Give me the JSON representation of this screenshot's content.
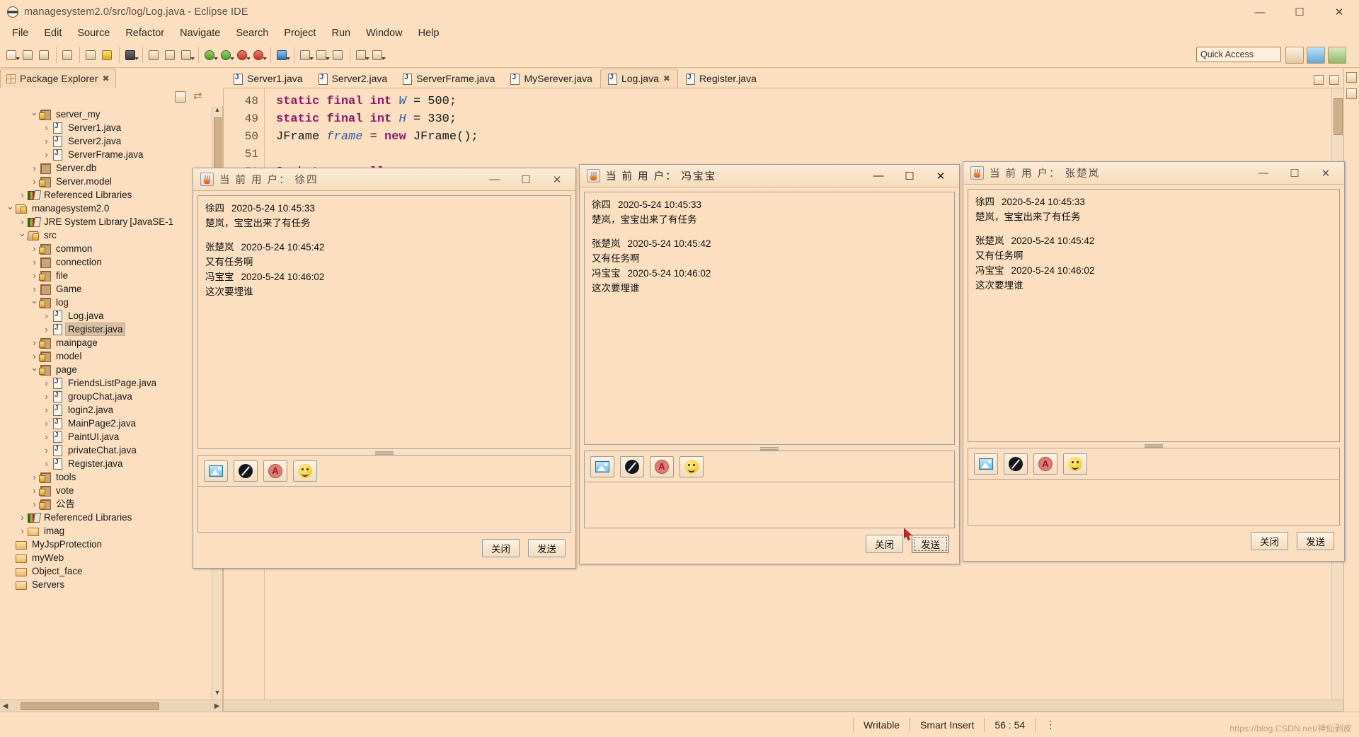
{
  "window": {
    "title": "managesystem2.0/src/log/Log.java - Eclipse IDE",
    "minimize": "—",
    "maximize": "☐",
    "close": "✕"
  },
  "menubar": [
    "File",
    "Edit",
    "Source",
    "Refactor",
    "Navigate",
    "Search",
    "Project",
    "Run",
    "Window",
    "Help"
  ],
  "toolbar": {
    "quick_access": "Quick Access"
  },
  "explorer": {
    "tab_label": "Package Explorer",
    "tab_close": "✖",
    "items": [
      {
        "label": "server_my",
        "indent": 3,
        "arrow": "open",
        "icon": "pkg-lock"
      },
      {
        "label": "Server1.java",
        "indent": 4,
        "arrow": "closed",
        "icon": "java"
      },
      {
        "label": "Server2.java",
        "indent": 4,
        "arrow": "closed",
        "icon": "java"
      },
      {
        "label": "ServerFrame.java",
        "indent": 4,
        "arrow": "closed",
        "icon": "java"
      },
      {
        "label": "Server.db",
        "indent": 3,
        "arrow": "closed",
        "icon": "pkg"
      },
      {
        "label": "Server.model",
        "indent": 3,
        "arrow": "closed",
        "icon": "pkg-lock"
      },
      {
        "label": "Referenced Libraries",
        "indent": 2,
        "arrow": "closed",
        "icon": "lib"
      },
      {
        "label": "managesystem2.0",
        "indent": 1,
        "arrow": "open",
        "icon": "proj"
      },
      {
        "label": "JRE System Library",
        "dim": " [JavaSE-1",
        "indent": 2,
        "arrow": "closed",
        "icon": "lib"
      },
      {
        "label": "src",
        "indent": 2,
        "arrow": "open",
        "icon": "src"
      },
      {
        "label": "common",
        "indent": 3,
        "arrow": "closed",
        "icon": "pkg-lock"
      },
      {
        "label": "connection",
        "indent": 3,
        "arrow": "closed",
        "icon": "pkg"
      },
      {
        "label": "file",
        "indent": 3,
        "arrow": "closed",
        "icon": "pkg-lock"
      },
      {
        "label": "Game",
        "indent": 3,
        "arrow": "closed",
        "icon": "pkg"
      },
      {
        "label": "log",
        "indent": 3,
        "arrow": "open",
        "icon": "pkg-lock"
      },
      {
        "label": "Log.java",
        "indent": 4,
        "arrow": "closed",
        "icon": "java"
      },
      {
        "label": "Register.java",
        "indent": 4,
        "arrow": "closed",
        "icon": "java",
        "selected": true
      },
      {
        "label": "mainpage",
        "indent": 3,
        "arrow": "closed",
        "icon": "pkg-lock"
      },
      {
        "label": "model",
        "indent": 3,
        "arrow": "closed",
        "icon": "pkg-lock"
      },
      {
        "label": "page",
        "indent": 3,
        "arrow": "open",
        "icon": "pkg-lock"
      },
      {
        "label": "FriendsListPage.java",
        "indent": 4,
        "arrow": "closed",
        "icon": "java"
      },
      {
        "label": "groupChat.java",
        "indent": 4,
        "arrow": "closed",
        "icon": "java"
      },
      {
        "label": "login2.java",
        "indent": 4,
        "arrow": "closed",
        "icon": "java"
      },
      {
        "label": "MainPage2.java",
        "indent": 4,
        "arrow": "closed",
        "icon": "java"
      },
      {
        "label": "PaintUI.java",
        "indent": 4,
        "arrow": "closed",
        "icon": "java"
      },
      {
        "label": "privateChat.java",
        "indent": 4,
        "arrow": "closed",
        "icon": "java"
      },
      {
        "label": "Register.java",
        "indent": 4,
        "arrow": "closed",
        "icon": "java"
      },
      {
        "label": "tools",
        "indent": 3,
        "arrow": "closed",
        "icon": "pkg-lock"
      },
      {
        "label": "vote",
        "indent": 3,
        "arrow": "closed",
        "icon": "pkg-lock"
      },
      {
        "label": "公告",
        "indent": 3,
        "arrow": "closed",
        "icon": "pkg-lock"
      },
      {
        "label": "Referenced Libraries",
        "indent": 2,
        "arrow": "closed",
        "icon": "lib"
      },
      {
        "label": "imag",
        "indent": 2,
        "arrow": "closed",
        "icon": "folder"
      },
      {
        "label": "MyJspProtection",
        "indent": 1,
        "arrow": "none",
        "icon": "folder"
      },
      {
        "label": "myWeb",
        "indent": 1,
        "arrow": "none",
        "icon": "folder"
      },
      {
        "label": "Object_face",
        "indent": 1,
        "arrow": "none",
        "icon": "folder"
      },
      {
        "label": "Servers",
        "indent": 1,
        "arrow": "none",
        "icon": "folder"
      }
    ]
  },
  "editor": {
    "tabs": [
      {
        "label": "Server1.java",
        "active": false
      },
      {
        "label": "Server2.java",
        "active": false
      },
      {
        "label": "ServerFrame.java",
        "active": false
      },
      {
        "label": "MySerever.java",
        "active": false
      },
      {
        "label": "Log.java",
        "active": true,
        "close": "✖"
      },
      {
        "label": "Register.java",
        "active": false
      }
    ],
    "lines": [
      {
        "no": "48",
        "text": "static final int W = 500;"
      },
      {
        "no": "49",
        "text": "static final int H = 330;"
      },
      {
        "no": "50",
        "text": "JFrame frame = new JFrame();"
      },
      {
        "no": "51",
        "text": ""
      },
      {
        "no": "52",
        "text": "Socket s = null;"
      }
    ],
    "below_text": {
      "who": "冯宝宝",
      "time": "2020-5-24 10:46:02",
      "body": "这次要埋谁"
    }
  },
  "statusbar": {
    "writable": "Writable",
    "insert_mode": "Smart Insert",
    "position": "56 : 54",
    "watermark": "https://blog.CSDN.net/神仙剥皮"
  },
  "chat_windows": [
    {
      "id": "xusi",
      "title": "当 前 用 户： 徐四",
      "focused": false,
      "messages": [
        {
          "who": "徐四",
          "time": "2020-5-24 10:45:33",
          "body": "楚岚，宝宝出来了有任务"
        },
        {
          "who": "张楚岚",
          "time": "2020-5-24 10:45:42",
          "body": "又有任务啊"
        },
        {
          "who": "冯宝宝",
          "time": "2020-5-24 10:46:02",
          "body": "这次要埋谁"
        }
      ],
      "tools": [
        "image-icon",
        "slash-circle-icon",
        "font-a-icon",
        "smiley-icon"
      ],
      "input_value": "",
      "buttons": {
        "close": "关闭",
        "send": "发送"
      },
      "send_focused": false
    },
    {
      "id": "feng",
      "title": "当 前 用 户： 冯宝宝",
      "focused": true,
      "messages": [
        {
          "who": "徐四",
          "time": "2020-5-24 10:45:33",
          "body": "楚岚，宝宝出来了有任务"
        },
        {
          "who": "张楚岚",
          "time": "2020-5-24 10:45:42",
          "body": "又有任务啊"
        },
        {
          "who": "冯宝宝",
          "time": "2020-5-24 10:46:02",
          "body": "这次要埋谁"
        }
      ],
      "tools": [
        "image-icon",
        "slash-circle-icon",
        "font-a-icon",
        "smiley-icon"
      ],
      "input_value": "",
      "buttons": {
        "close": "关闭",
        "send": "发送"
      },
      "send_focused": true
    },
    {
      "id": "zhang",
      "title": "当 前 用 户： 张楚岚",
      "focused": false,
      "messages": [
        {
          "who": "徐四",
          "time": "2020-5-24 10:45:33",
          "body": "楚岚，宝宝出来了有任务"
        },
        {
          "who": "张楚岚",
          "time": "2020-5-24 10:45:42",
          "body": "又有任务啊"
        },
        {
          "who": "冯宝宝",
          "time": "2020-5-24 10:46:02",
          "body": "这次要埋谁"
        }
      ],
      "tools": [
        "image-icon",
        "slash-circle-icon",
        "font-a-icon",
        "smiley-icon"
      ],
      "input_value": "",
      "buttons": {
        "close": "关闭",
        "send": "发送"
      },
      "send_focused": false
    }
  ],
  "colors": {
    "background": "#fbdfc0",
    "accent_blue": "#2b5ea8",
    "keyword_magenta": "#8b1a6b",
    "selection": "#d9c0a4"
  }
}
